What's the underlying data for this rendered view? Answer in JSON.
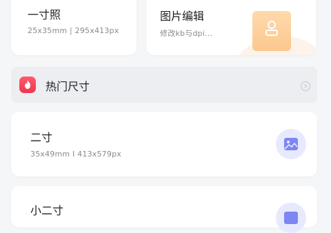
{
  "top_cards": [
    {
      "cut_title": "一寸照",
      "title": "一寸照",
      "subtitle": "25x35mm | 295x413px"
    },
    {
      "title": "图片编辑",
      "subtitle": "修改kb与dpi..."
    }
  ],
  "hot_section": {
    "label": "热门尺寸",
    "icon": "fire-icon",
    "arrow_icon": "chevron-right-icon"
  },
  "sizes": [
    {
      "title": "二寸",
      "subtitle": "35x49mm  I  413x579px",
      "icon": "image-icon"
    },
    {
      "title": "小二寸",
      "subtitle": "",
      "icon": "image-icon"
    }
  ],
  "colors": {
    "background": "#f5f6f8",
    "card": "#ffffff",
    "hot_bar": "#eceef2",
    "fire_badge": "#f0364f",
    "edit_icon": "#fbc88f",
    "photo_icon_bg": "#e7eafe",
    "photo_icon_fg": "#7d86f3"
  }
}
